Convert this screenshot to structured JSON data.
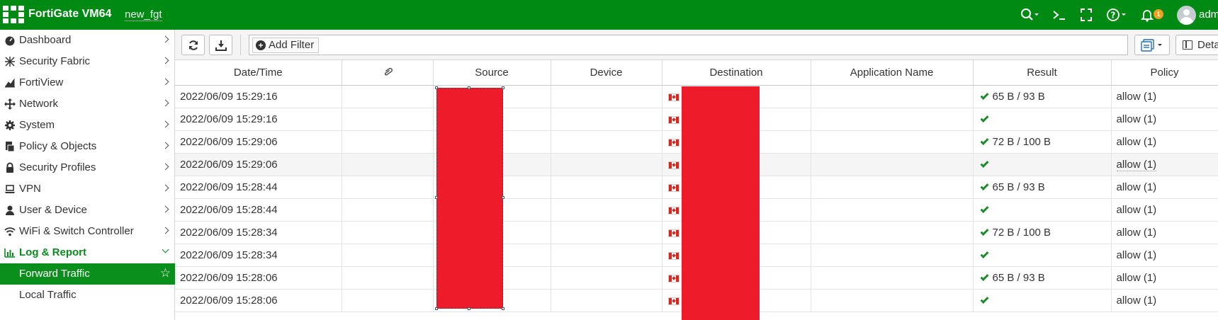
{
  "app": {
    "brand": "FortiGate VM64",
    "hostname": "new_fgt",
    "notification_count": "1",
    "username": "adm"
  },
  "colors": {
    "topbar": "#008a13",
    "active_nav": "#0a8f1c",
    "redaction": "#ee1c2a",
    "check": "#1c8a2e"
  },
  "sidebar": {
    "items": [
      {
        "label": "Dashboard",
        "icon": "dashboard-icon"
      },
      {
        "label": "Security Fabric",
        "icon": "security-fabric-icon"
      },
      {
        "label": "FortiView",
        "icon": "fortiview-icon"
      },
      {
        "label": "Network",
        "icon": "network-icon"
      },
      {
        "label": "System",
        "icon": "gear-icon"
      },
      {
        "label": "Policy & Objects",
        "icon": "policy-icon"
      },
      {
        "label": "Security Profiles",
        "icon": "lock-icon"
      },
      {
        "label": "VPN",
        "icon": "laptop-icon"
      },
      {
        "label": "User & Device",
        "icon": "user-icon"
      },
      {
        "label": "WiFi & Switch Controller",
        "icon": "wifi-icon"
      },
      {
        "label": "Log & Report",
        "icon": "bar-chart-icon"
      }
    ],
    "sub_items": [
      {
        "label": "Forward Traffic"
      },
      {
        "label": "Local Traffic"
      }
    ]
  },
  "toolbar": {
    "add_filter_label": "Add Filter",
    "details_label": "Details"
  },
  "table": {
    "columns": [
      "Date/Time",
      "",
      "Source",
      "Device",
      "Destination",
      "Application Name",
      "Result",
      "Policy"
    ],
    "rows": [
      {
        "datetime": "2022/06/09 15:29:16",
        "result": "65 B / 93 B",
        "policy": "allow (1)"
      },
      {
        "datetime": "2022/06/09 15:29:16",
        "result": "",
        "policy": "allow (1)"
      },
      {
        "datetime": "2022/06/09 15:29:06",
        "result": "72 B / 100 B",
        "policy": "allow (1)"
      },
      {
        "datetime": "2022/06/09 15:29:06",
        "result": "",
        "policy": "allow (1)"
      },
      {
        "datetime": "2022/06/09 15:28:44",
        "result": "65 B / 93 B",
        "policy": "allow (1)"
      },
      {
        "datetime": "2022/06/09 15:28:44",
        "result": "",
        "policy": "allow (1)"
      },
      {
        "datetime": "2022/06/09 15:28:34",
        "result": "72 B / 100 B",
        "policy": "allow (1)"
      },
      {
        "datetime": "2022/06/09 15:28:34",
        "result": "",
        "policy": "allow (1)"
      },
      {
        "datetime": "2022/06/09 15:28:06",
        "result": "65 B / 93 B",
        "policy": "allow (1)"
      },
      {
        "datetime": "2022/06/09 15:28:06",
        "result": "",
        "policy": "allow (1)"
      }
    ]
  }
}
